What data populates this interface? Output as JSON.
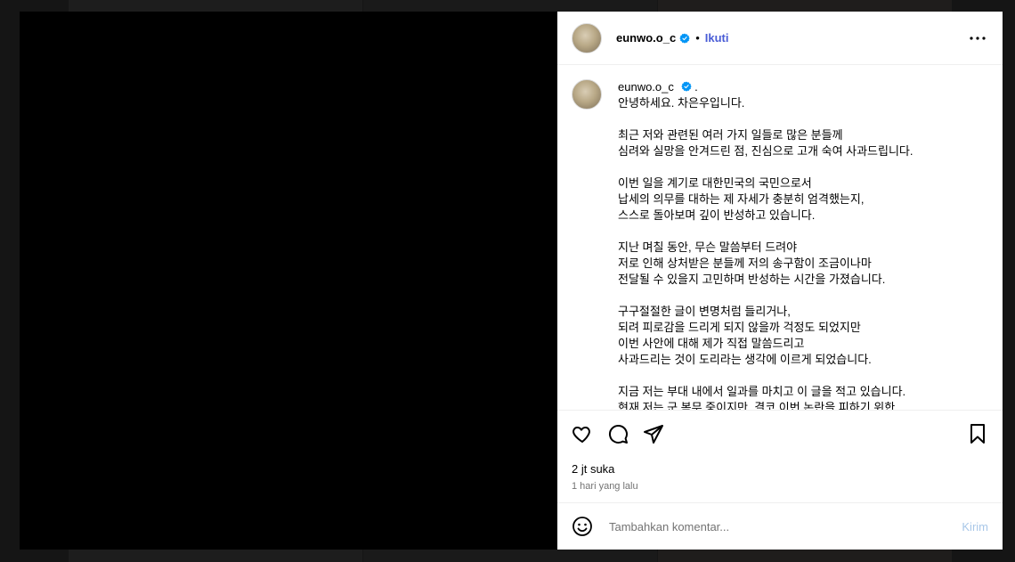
{
  "post": {
    "username": "eunwo.o_c",
    "separator": "•",
    "follow_label": "Ikuti",
    "caption_user": "eunwo.o_c",
    "caption_dot": ".",
    "caption_lines": [
      "안녕하세요. 차은우입니다.",
      "",
      "최근 저와 관련된 여러 가지 일들로 많은 분들께",
      "심려와 실망을 안겨드린 점, 진심으로 고개 숙여 사과드립니다.",
      "",
      "이번 일을 계기로 대한민국의 국민으로서",
      "납세의 의무를 대하는 제 자세가 충분히 엄격했는지,",
      "스스로 돌아보며 깊이 반성하고 있습니다.",
      "",
      "지난 며칠 동안, 무슨 말씀부터 드려야",
      "저로 인해 상처받은 분들께 저의 송구함이 조금이나마",
      "전달될 수 있을지 고민하며 반성하는 시간을 가졌습니다.",
      "",
      "구구절절한 글이 변명처럼 들리거나,",
      "되려 피로감을 드리게 되지 않을까 걱정도 되었지만",
      "이번 사안에 대해 제가 직접 말씀드리고",
      "사과드리는 것이 도리라는 생각에 이르게 되었습니다.",
      "",
      "지금 저는 부대 내에서 일과를 마치고 이 글을 적고 있습니다.",
      "현재 저는 군 복무 중이지만, 결코 이번 논란을 피하기 위한"
    ],
    "likes": "2 jt suka",
    "time_ago": "1 hari yang lalu"
  },
  "comment": {
    "placeholder": "Tambahkan komentar...",
    "send_label": "Kirim"
  },
  "icons": [
    "heart-icon",
    "comment-icon",
    "share-icon",
    "bookmark-icon",
    "more-icon",
    "emoji-icon",
    "verified-badge-icon"
  ],
  "colors": {
    "follow": "#4a5dd6",
    "verified": "#0095f6",
    "send_disabled": "#a8c7e8",
    "media_bg": "#000000",
    "backdrop": "#3d3d3d"
  }
}
